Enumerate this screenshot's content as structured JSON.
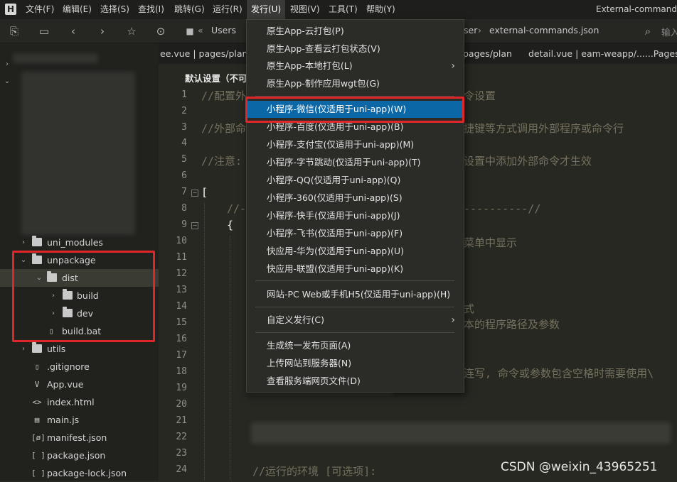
{
  "menubar": {
    "items": [
      "文件(F)",
      "编辑(E)",
      "选择(S)",
      "查找(I)",
      "跳转(G)",
      "运行(R)",
      "发行(U)",
      "视图(V)",
      "工具(T)",
      "帮助(Y)"
    ],
    "window_title": "External-commands"
  },
  "toolbar": {
    "crumbs": [
      "Users",
      "ser",
      "external-commands.json"
    ],
    "search_placeholder": "输入"
  },
  "sidebar": {
    "items": [
      {
        "label": "uni_modules",
        "type": "folder",
        "expanded": false
      },
      {
        "label": "unpackage",
        "type": "folder",
        "expanded": true
      },
      {
        "label": "dist",
        "type": "folder",
        "expanded": true
      },
      {
        "label": "build",
        "type": "folder",
        "expanded": false
      },
      {
        "label": "dev",
        "type": "folder",
        "expanded": false
      },
      {
        "label": "build.bat",
        "type": "file"
      },
      {
        "label": "utils",
        "type": "folder",
        "expanded": false
      },
      {
        "label": ".gitignore",
        "type": "file"
      },
      {
        "label": "App.vue",
        "type": "vue"
      },
      {
        "label": "index.html",
        "type": "html"
      },
      {
        "label": "main.js",
        "type": "js"
      },
      {
        "label": "manifest.json",
        "type": "json"
      },
      {
        "label": "package.json",
        "type": "json"
      },
      {
        "label": "package-lock.json",
        "type": "json"
      }
    ]
  },
  "tabs": [
    "ee.vue | pages/plan...",
    "pages/plan",
    "detail.vue | eam-weapp/......Pages/p"
  ],
  "editor": {
    "settings_title": "默认设置（不可",
    "line_numbers": [
      "1",
      "2",
      "3",
      "4",
      "5",
      "6",
      "7",
      "8",
      "9",
      "10",
      "11",
      "12",
      "13",
      "14",
      "15",
      "16",
      "17",
      "18",
      "19",
      "20",
      "21",
      "22",
      "23",
      "24"
    ],
    "code_fragments": {
      "l1a": "//配置外",
      "l1b": "令设置",
      "l3a": "//外部命",
      "l3b": "捷键等方式调用外部程序或命令行",
      "l5a": "//注意:",
      "l5b": "设置中添加外部命令才生效",
      "l7": "[",
      "l8a": "//-",
      "l8b": "----------//",
      "l9": "{",
      "l10": "菜单中显示",
      "l14": "式",
      "l15": "本的程序路径及参数",
      "l18": "连写, 命令或参数包含空格时需要使用\\",
      "l24": "//运行的环境 [可选项]:"
    }
  },
  "dropdown": {
    "items": [
      {
        "label": "原生App-云打包(P)",
        "submenu": false
      },
      {
        "label": "原生App-查看云打包状态(V)",
        "submenu": false
      },
      {
        "label": "原生App-本地打包(L)",
        "submenu": true
      },
      {
        "label": "原生App-制作应用wgt包(G)",
        "submenu": false
      },
      {
        "label": "小程序-微信(仅适用于uni-app)(W)",
        "submenu": false,
        "highlighted": true
      },
      {
        "label": "小程序-百度(仅适用于uni-app)(B)",
        "submenu": false
      },
      {
        "label": "小程序-支付宝(仅适用于uni-app)(M)",
        "submenu": false
      },
      {
        "label": "小程序-字节跳动(仅适用于uni-app)(T)",
        "submenu": false
      },
      {
        "label": "小程序-QQ(仅适用于uni-app)(Q)",
        "submenu": false
      },
      {
        "label": "小程序-360(仅适用于uni-app)(S)",
        "submenu": false
      },
      {
        "label": "小程序-快手(仅适用于uni-app)(J)",
        "submenu": false
      },
      {
        "label": "小程序-飞书(仅适用于uni-app)(F)",
        "submenu": false
      },
      {
        "label": "快应用-华为(仅适用于uni-app)(U)",
        "submenu": false
      },
      {
        "label": "快应用-联盟(仅适用于uni-app)(K)",
        "submenu": false
      },
      {
        "label": "网站-PC Web或手机H5(仅适用于uni-app)(H)",
        "submenu": false
      },
      {
        "label": "自定义发行(C)",
        "submenu": true
      },
      {
        "label": "生成统一发布页面(A)",
        "submenu": false
      },
      {
        "label": "上传网站到服务器(N)",
        "submenu": false
      },
      {
        "label": "查看服务端网页文件(D)",
        "submenu": false
      }
    ]
  },
  "watermark": "CSDN @weixin_43965251",
  "colors": {
    "highlight": "#0b67a6",
    "annotation_red": "#e0262b",
    "background": "#272822"
  }
}
